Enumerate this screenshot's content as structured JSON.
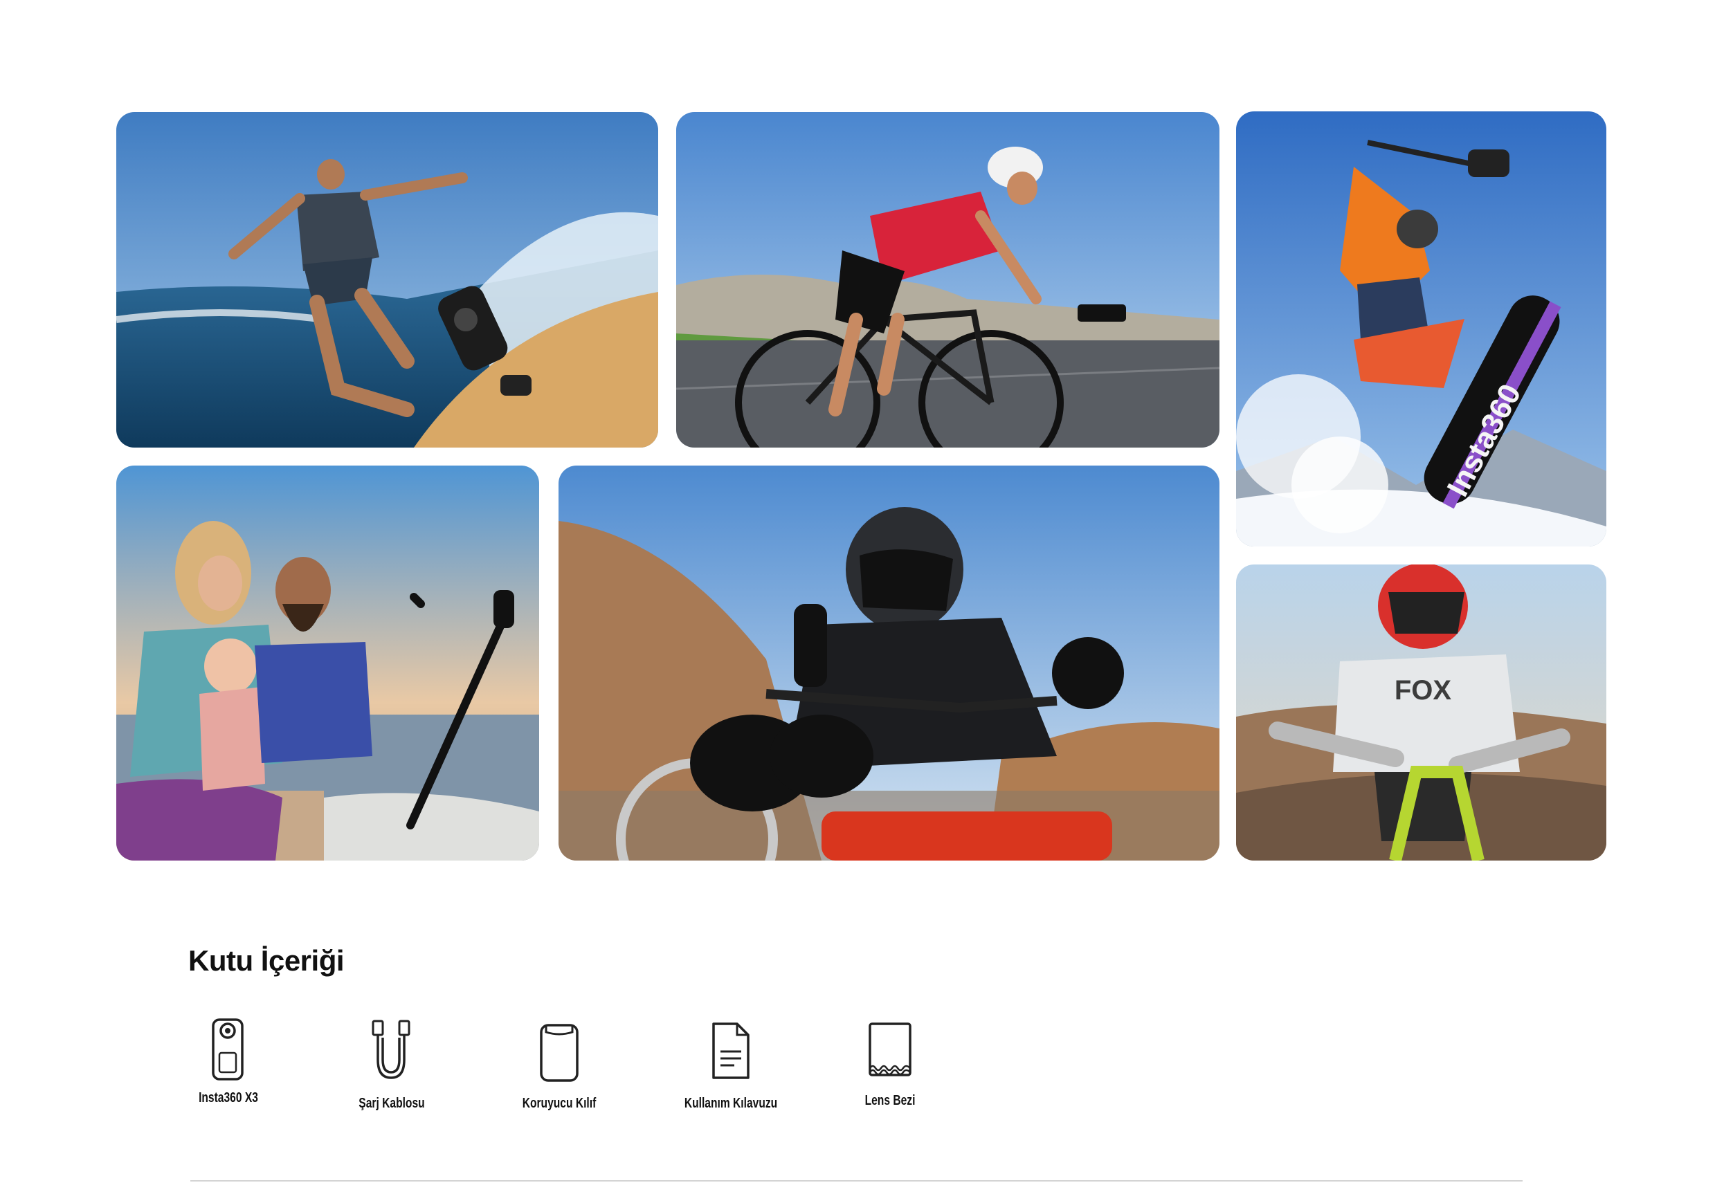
{
  "gallery": [
    {
      "scene": "surfing"
    },
    {
      "scene": "road-cycling"
    },
    {
      "scene": "snowboarding",
      "brand_text": "Insta360"
    },
    {
      "scene": "family-beach"
    },
    {
      "scene": "motorcycle"
    },
    {
      "scene": "mountain-biking",
      "jersey_text": "FOX"
    }
  ],
  "box_contents": {
    "title": "Kutu İçeriği",
    "items": [
      {
        "label": "Insta360 X3",
        "icon": "camera-icon"
      },
      {
        "label": "Şarj Kablosu",
        "icon": "cable-icon"
      },
      {
        "label": "Koruyucu Kılıf",
        "icon": "pouch-icon"
      },
      {
        "label": "Kullanım Kılavuzu",
        "icon": "manual-icon"
      },
      {
        "label": "Lens Bezi",
        "icon": "lens-cloth-icon"
      }
    ]
  },
  "colors": {
    "text": "#111111",
    "divider": "#d4d4d4",
    "icon_stroke": "#222222"
  }
}
